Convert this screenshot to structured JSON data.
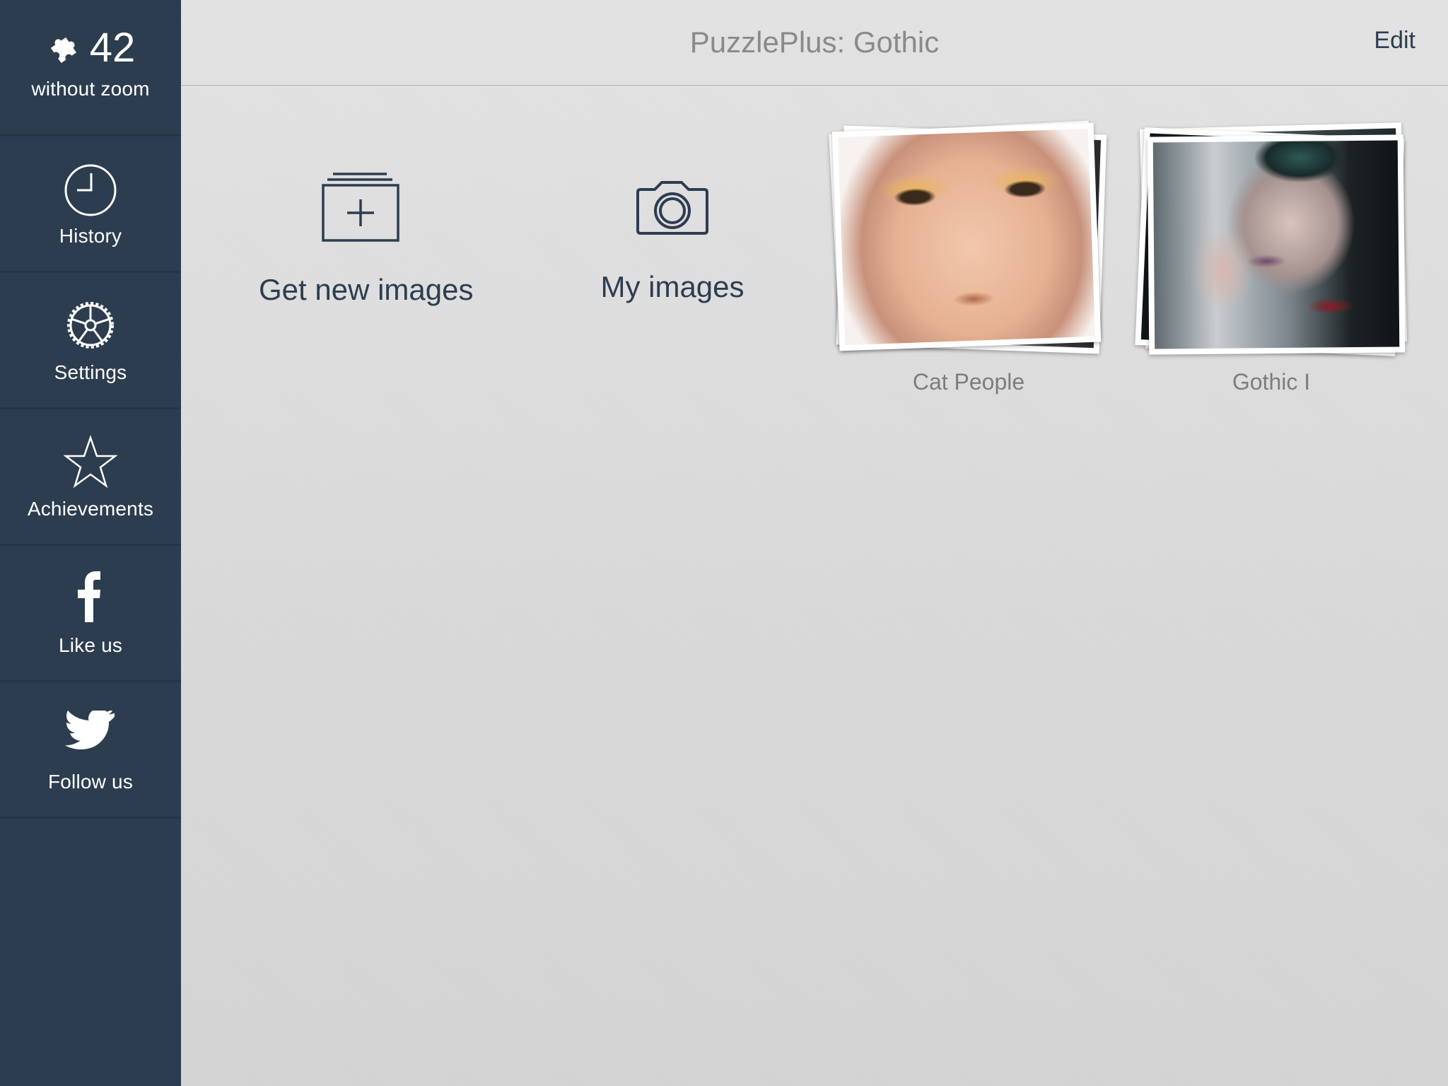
{
  "sidebar": {
    "counter": {
      "icon": "puzzle-piece-icon",
      "value": "42",
      "caption": "without zoom"
    },
    "items": [
      {
        "id": "history",
        "icon": "clock-icon",
        "label": "History"
      },
      {
        "id": "settings",
        "icon": "gear-icon",
        "label": "Settings"
      },
      {
        "id": "achievements",
        "icon": "star-icon",
        "label": "Achievements"
      },
      {
        "id": "like-us",
        "icon": "facebook-icon",
        "label": "Like us"
      },
      {
        "id": "follow-us",
        "icon": "twitter-icon",
        "label": "Follow us"
      }
    ]
  },
  "header": {
    "title": "PuzzlePlus: Gothic",
    "edit_label": "Edit"
  },
  "actions": [
    {
      "id": "get-new-images",
      "icon": "add-images-icon",
      "label": "Get new images"
    },
    {
      "id": "my-images",
      "icon": "camera-icon",
      "label": "My images"
    }
  ],
  "albums": [
    {
      "id": "cat-people",
      "title": "Cat People"
    },
    {
      "id": "gothic-1",
      "title": "Gothic I"
    }
  ],
  "colors": {
    "sidebar_bg": "#2d3d50",
    "accent": "#2d3d50",
    "title_text": "#8a8a8a",
    "album_label": "#7d7d7d"
  }
}
